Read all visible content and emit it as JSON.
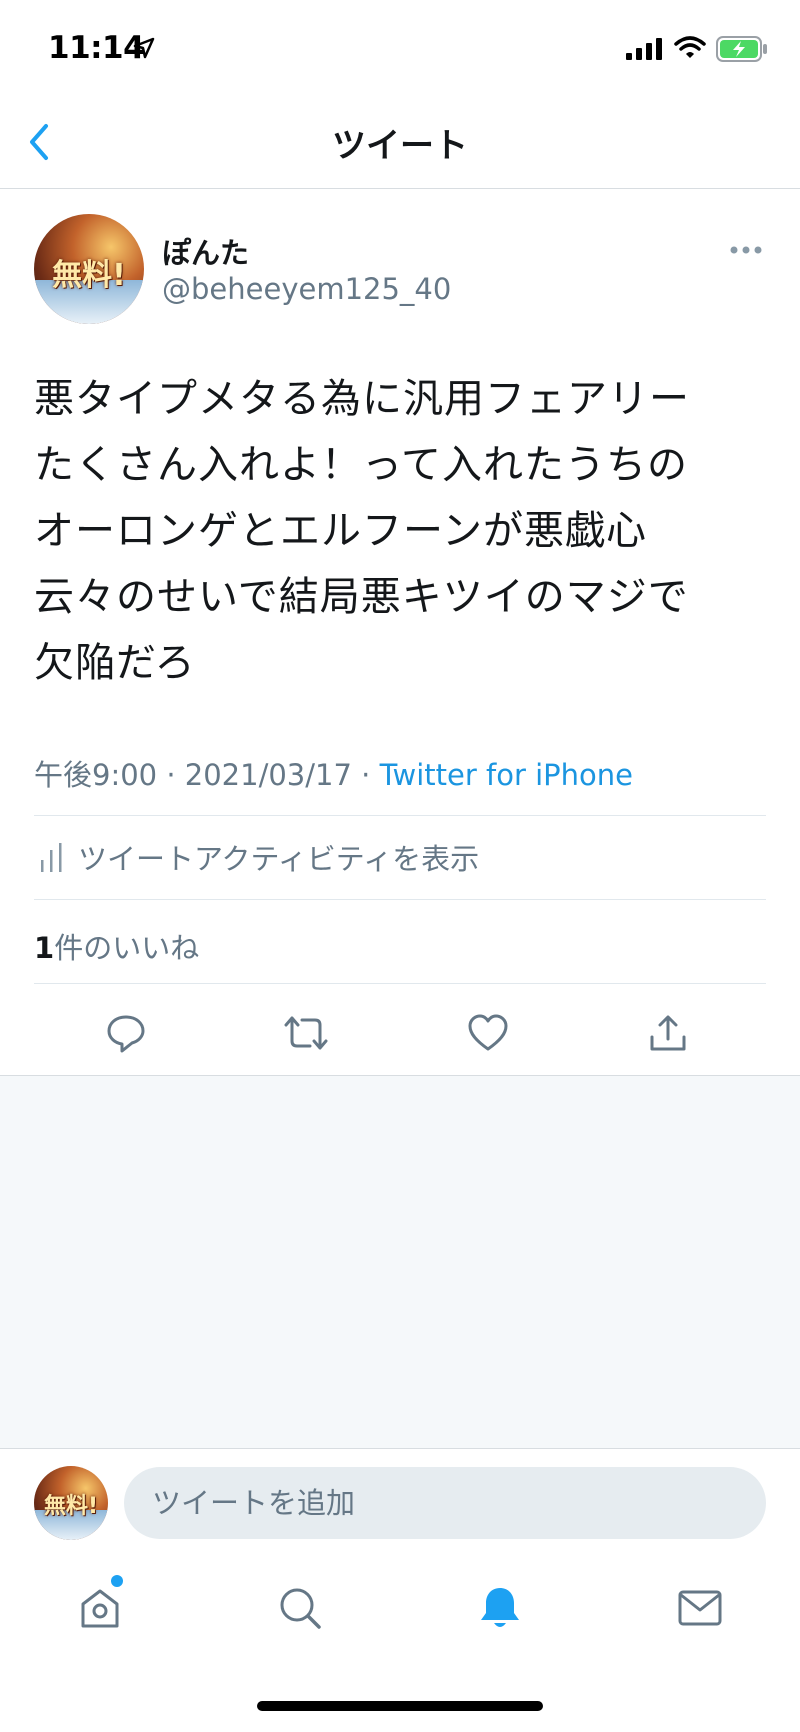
{
  "status_bar": {
    "time": "11:14"
  },
  "nav": {
    "title": "ツイート"
  },
  "tweet": {
    "display_name": "ぽんた",
    "handle": "@beheeyem125_40",
    "avatar_text": "無料!",
    "text_lines": [
      "悪タイプメタる為に汎用フェアリー",
      "たくさん入れよ！って入れたうちの",
      "オーロンゲとエルフーンが悪戯心",
      "云々のせいで結局悪キツイのマジで",
      "欠陥だろ"
    ],
    "time": "午後9:00",
    "separator": "·",
    "date": "2021/03/17",
    "source": "Twitter for iPhone",
    "activity_label": "ツイートアクティビティを表示",
    "likes_count": "1",
    "likes_label": "件のいいね"
  },
  "composer": {
    "placeholder": "ツイートを追加"
  },
  "icons": {
    "back": "chevron-left-icon",
    "more": "more-horizontal-icon",
    "activity": "bar-chart-icon",
    "reply": "reply-icon",
    "retweet": "retweet-icon",
    "like": "heart-icon",
    "share": "share-icon",
    "home": "home-icon",
    "search": "search-icon",
    "notifications": "bell-icon",
    "messages": "mail-icon"
  },
  "colors": {
    "accent": "#1da1f2",
    "link": "#1b95e0",
    "secondary_text": "#657786",
    "battery": "#4cd964"
  }
}
